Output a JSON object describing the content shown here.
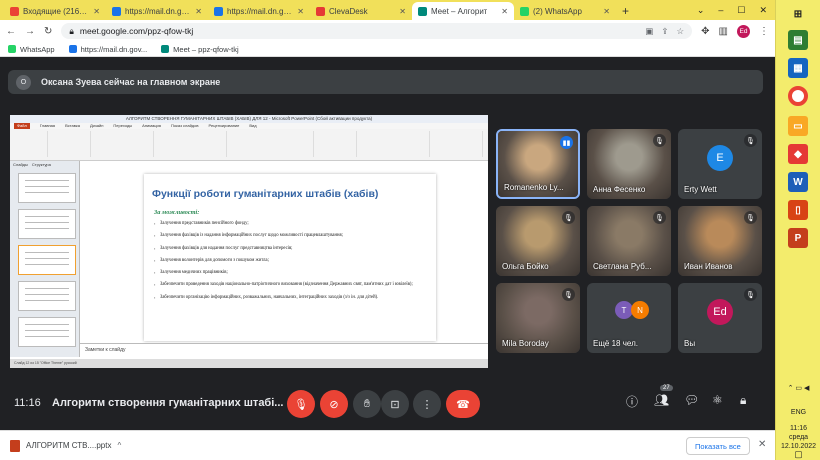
{
  "tabs": [
    {
      "title": "Входящие (216) - pz",
      "color": "#ea4335",
      "active": false
    },
    {
      "title": "https://mail.dn.gov.u",
      "color": "#1a73e8",
      "active": false
    },
    {
      "title": "https://mail.dn.gov.u",
      "color": "#1a73e8",
      "active": false
    },
    {
      "title": "ClevaDesk",
      "color": "#e53935",
      "active": false
    },
    {
      "title": "Meet – Алгорит",
      "color": "#00897b",
      "active": true
    },
    {
      "title": "(2) WhatsApp",
      "color": "#25d366",
      "active": false
    }
  ],
  "window_controls": [
    "–",
    "☐",
    "✕"
  ],
  "address": {
    "url": "meet.google.com/ppz-qfow-tkj",
    "avatar": "Ed"
  },
  "bookmarks": [
    {
      "label": "WhatsApp",
      "color": "#25d366"
    },
    {
      "label": "https://mail.dn.gov...",
      "color": "#1a73e8"
    },
    {
      "label": "Meet – ppz-qfow-tkj",
      "color": "#00897b"
    }
  ],
  "banner": {
    "avatar": "О",
    "text": "Оксана Зуева сейчас на главном экране"
  },
  "presentation": {
    "window_title": "АЛГОРИТМ СТВОРЕННЯ ГУМАНІТАРНИХ ШТАБІВ (ХАБІВ) ДЛЯ 12 - Microsoft PowerPoint (Сбой активации продукта)",
    "ribbon_tabs": [
      "Файл",
      "Главная",
      "Вставка",
      "Дизайн",
      "Переходы",
      "Анимация",
      "Показ слайдов",
      "Рецензирование",
      "Вид"
    ],
    "panel_tabs": [
      "Слайды",
      "Структура"
    ],
    "slide_title": "Функції роботи гуманітарних штабів (хабів)",
    "slide_subtitle": "За можливості:",
    "bullets": [
      "Залучення представників пенсійного фонду;",
      "Залучення фахівців із надання інформаційних послуг щодо можливості працевлаштування;",
      "Залучення фахівців для надання послуг представництва інтересів;",
      "Залучення волонтерів для допомоги з пошуком житла;",
      "Залучення медичних працівників;",
      "Забезпечити проведення заходів національно-патріотичного виховання (відзначення Державних свят, пам'ятних дат і ювілеїв);",
      "Забезпечити організацію інформаційних, розважальних, навчальних, інтеграційних заходів (з/з ін. для дітей)."
    ],
    "notes_placeholder": "Заметки к слайду",
    "status": "Слайд 12 из 15   \"Office Theme\"   русский"
  },
  "participants": [
    {
      "name": "Romanenko Ly...",
      "speaking": true,
      "type": "photo",
      "bg": "#c9a77f"
    },
    {
      "name": "Анна Фесенко",
      "speaking": false,
      "type": "photo",
      "bg": "#9e9a8e"
    },
    {
      "name": "Erty Wett",
      "speaking": false,
      "type": "avatar",
      "initial": "E",
      "color": "#1e88e5"
    },
    {
      "name": "Ольга Бойко",
      "speaking": false,
      "type": "photo",
      "bg": "#b89a6e"
    },
    {
      "name": "Светлана Руб...",
      "speaking": false,
      "type": "photo",
      "bg": "#8a7a66"
    },
    {
      "name": "Иван Иванов",
      "speaking": false,
      "type": "photo",
      "bg": "#b98a5a"
    },
    {
      "name": "Mila Boroday",
      "speaking": false,
      "type": "photo",
      "bg": "#7c6a64"
    },
    {
      "name": "Ещё 18 чел.",
      "speaking": false,
      "type": "more",
      "initials": [
        "T",
        "N"
      ]
    },
    {
      "name": "Вы",
      "speaking": false,
      "type": "avatar",
      "initial": "Ed",
      "color": "#c2185b"
    }
  ],
  "meeting": {
    "time": "11:16",
    "title": "Алгоритм створення гуманітарних штабі...",
    "participant_count": "27"
  },
  "download": {
    "file": "АЛГОРИТМ СТВ....pptx",
    "show_all": "Показать все"
  },
  "system": {
    "lang": "ENG",
    "time": "11:16",
    "day": "среда",
    "date": "12.10.2022"
  }
}
